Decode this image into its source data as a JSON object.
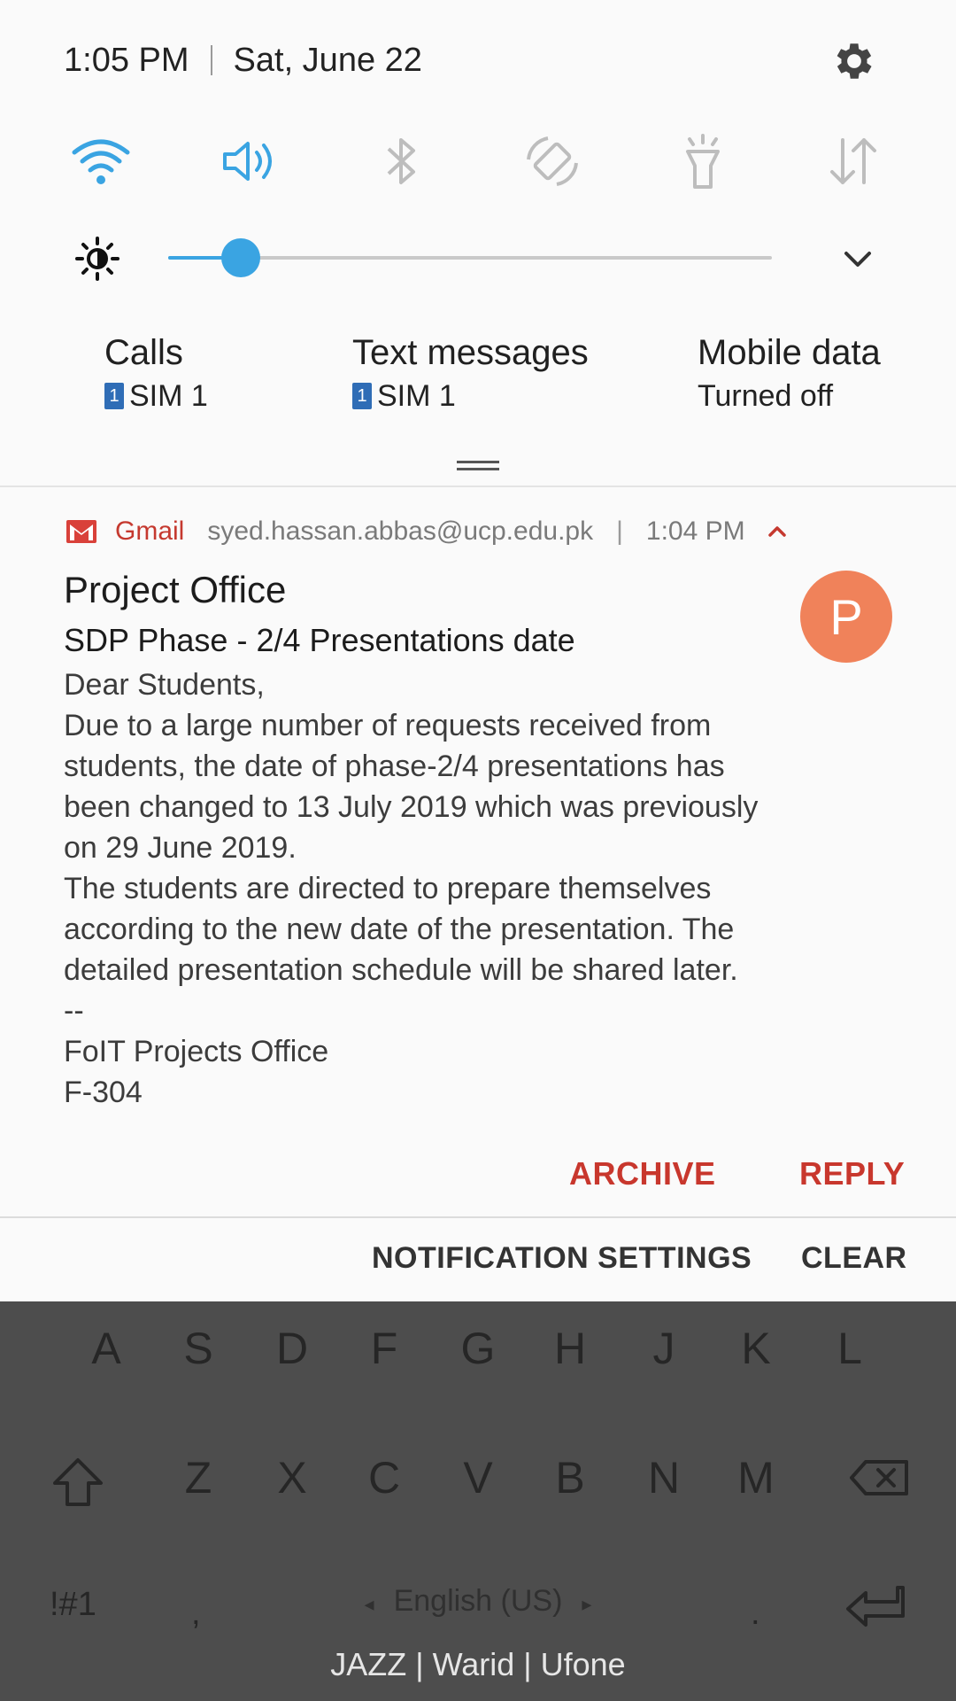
{
  "status": {
    "time": "1:05 PM",
    "date": "Sat, June 22"
  },
  "quick_settings": {
    "tiles": [
      {
        "icon": "wifi-icon",
        "active": true
      },
      {
        "icon": "sound-icon",
        "active": true
      },
      {
        "icon": "bluetooth-icon",
        "active": false
      },
      {
        "icon": "auto-rotate-icon",
        "active": false
      },
      {
        "icon": "flashlight-icon",
        "active": false
      },
      {
        "icon": "mobile-data-icon",
        "active": false
      }
    ],
    "brightness_level": 0.12
  },
  "sim": [
    {
      "title": "Calls",
      "badge": "1",
      "value": "SIM 1"
    },
    {
      "title": "Text messages",
      "badge": "1",
      "value": "SIM 1"
    },
    {
      "title": "Mobile data",
      "value": "Turned off"
    }
  ],
  "notification": {
    "app": "Gmail",
    "account": "syed.hassan.abbas@ucp.edu.pk",
    "time": "1:04 PM",
    "avatar_letter": "P",
    "sender": "Project Office",
    "subject": "SDP Phase - 2/4 Presentations date",
    "body_lines": [
      "Dear Students,",
      "Due to a large number of requests received from",
      "students, the date of phase-2/4 presentations has",
      "been changed to 13 July 2019 which was previously",
      "on 29 June 2019.",
      "The students are directed to prepare themselves",
      "according to the new date of the presentation. The",
      "detailed presentation schedule will be shared later.",
      "--",
      "FoIT Projects Office",
      "F-304"
    ],
    "actions": {
      "archive": "ARCHIVE",
      "reply": "REPLY"
    }
  },
  "footer": {
    "settings": "NOTIFICATION SETTINGS",
    "clear": "CLEAR"
  },
  "keyboard": {
    "row2": [
      "A",
      "S",
      "D",
      "F",
      "G",
      "H",
      "J",
      "K",
      "L"
    ],
    "row3": [
      "Z",
      "X",
      "C",
      "V",
      "B",
      "N",
      "M"
    ],
    "symbols": "!#1",
    "comma": ",",
    "period": ".",
    "language": "English (US)"
  },
  "carrier": "JAZZ | Warid | Ufone",
  "colors": {
    "accent": "#3aa4e2",
    "gmail_red": "#c5392f",
    "avatar": "#f0825a"
  }
}
